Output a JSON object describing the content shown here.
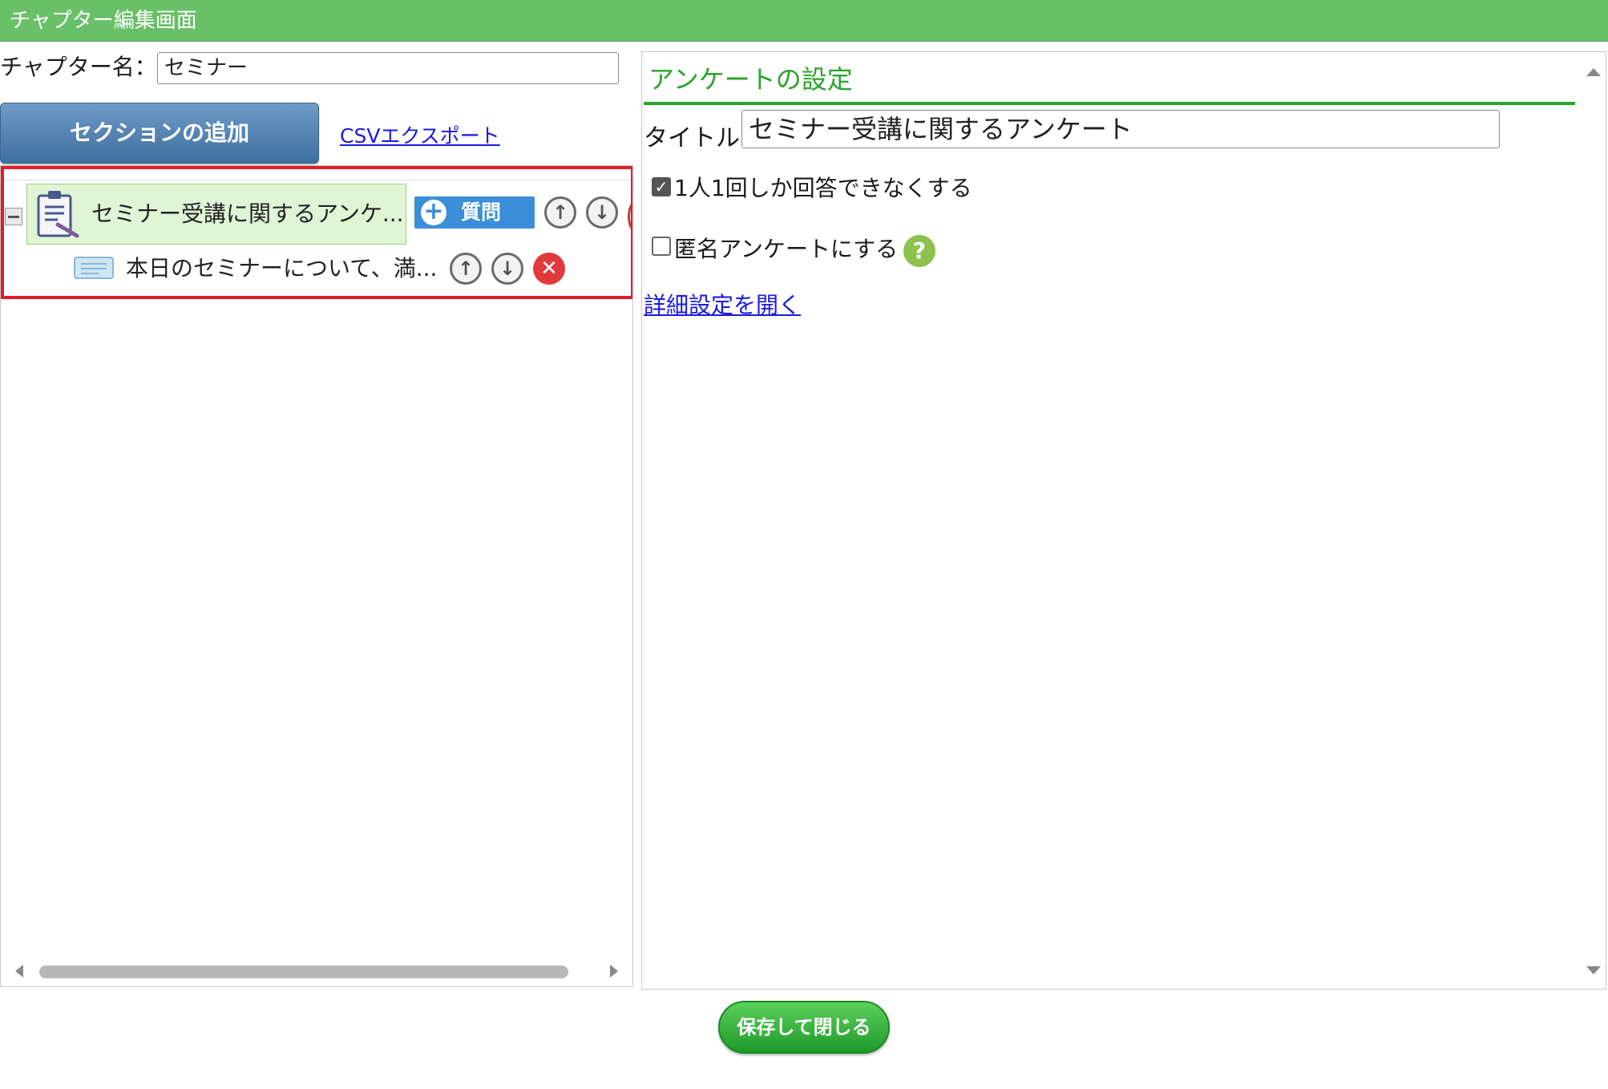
{
  "window": {
    "title": "チャプター編集画面"
  },
  "chapter": {
    "label": "チャプター名：",
    "value": "セミナー"
  },
  "toolbar": {
    "add_section_label": "セクションの追加",
    "csv_export_label": "CSVエクスポート"
  },
  "tree": {
    "survey_node": {
      "label": "セミナー受講に関するアンケ...",
      "add_question_label": "質問"
    },
    "question_node": {
      "label": "本日のセミナーについて、満..."
    },
    "icons": {
      "up": "arrow-up-circle-icon",
      "down": "arrow-down-circle-icon",
      "delete": "delete-x-icon"
    }
  },
  "settings": {
    "heading": "アンケートの設定",
    "title_label": "タイトル:",
    "title_value": "セミナー受講に関するアンケート",
    "option_once": {
      "label": "1人1回しか回答できなくする",
      "checked": true
    },
    "option_anonymous": {
      "label": "匿名アンケートにする",
      "checked": false
    },
    "help_glyph": "?",
    "detail_link": "詳細設定を開く"
  },
  "footer": {
    "save_close_label": "保存して閉じる"
  },
  "colors": {
    "header_green": "#6abf69",
    "accent_green": "#2aa42a",
    "button_blue": "#3a8fd8",
    "highlight_red": "#e01e2b"
  }
}
